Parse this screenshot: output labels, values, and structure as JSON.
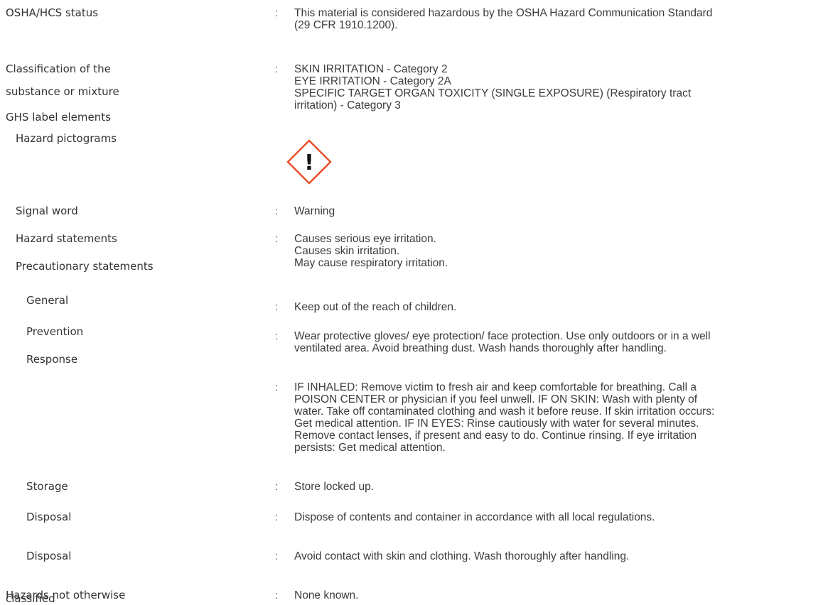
{
  "rows": {
    "osha_status": {
      "label": "OSHA/HCS status",
      "colon": ":",
      "value": [
        "This material is considered hazardous by the OSHA Hazard Communication Standard",
        "(29 CFR 1910.1200)."
      ]
    },
    "classification": {
      "label_line1": "Classification of the",
      "label_line2": "substance or mixture",
      "colon": ":",
      "value": [
        "SKIN IRRITATION - Category 2",
        "EYE IRRITATION - Category 2A",
        "SPECIFIC TARGET ORGAN TOXICITY (SINGLE EXPOSURE) (Respiratory tract",
        "irritation) - Category 3"
      ]
    },
    "ghs_label_elements": {
      "label": "GHS label elements"
    },
    "hazard_pictograms": {
      "label": "Hazard pictograms",
      "pictogram_icon": "exclamation-mark-diamond-icon",
      "pictogram_symbol": "!",
      "pictogram_color": "#e8502a"
    },
    "signal_word": {
      "label": "Signal word",
      "colon": ":",
      "value": "Warning"
    },
    "hazard_statements": {
      "label": "Hazard statements",
      "colon": ":",
      "value": [
        "Causes serious eye irritation.",
        "Causes skin irritation.",
        "May cause respiratory irritation."
      ]
    },
    "precautionary_statements": {
      "label": "Precautionary statements"
    },
    "general": {
      "label": "General",
      "colon": ":",
      "value": "Keep out of the reach of children."
    },
    "prevention": {
      "label": "Prevention",
      "colon": ":",
      "value": [
        "Wear protective gloves/ eye protection/ face protection. Use only outdoors or in a well",
        "ventilated area. Avoid breathing dust. Wash hands thoroughly after handling."
      ]
    },
    "response": {
      "label": "Response",
      "colon": ":",
      "value": [
        "IF INHALED: Remove victim to fresh air and keep comfortable for breathing. Call a",
        "POISON CENTER or physician if you feel unwell. IF ON SKIN: Wash with plenty of",
        "water. Take off contaminated clothing and wash it before reuse. If skin irritation occurs:",
        "Get medical attention. IF IN EYES: Rinse cautiously with water for several minutes.",
        "Remove contact lenses, if present and easy to do. Continue rinsing. If eye irritation",
        "persists: Get medical attention."
      ]
    },
    "storage": {
      "label": "Storage",
      "colon": ":",
      "value": "Store locked up."
    },
    "disposal_1": {
      "label": "Disposal",
      "colon": ":",
      "value": "Dispose of contents and container in accordance with all local regulations."
    },
    "disposal_2": {
      "label": "Disposal",
      "colon": ":",
      "value": "Avoid contact with skin and clothing. Wash thoroughly after handling."
    },
    "hnoc": {
      "label_line1": "Hazards not otherwise",
      "label_line2": "classified",
      "colon": ":",
      "value": "None known."
    }
  }
}
